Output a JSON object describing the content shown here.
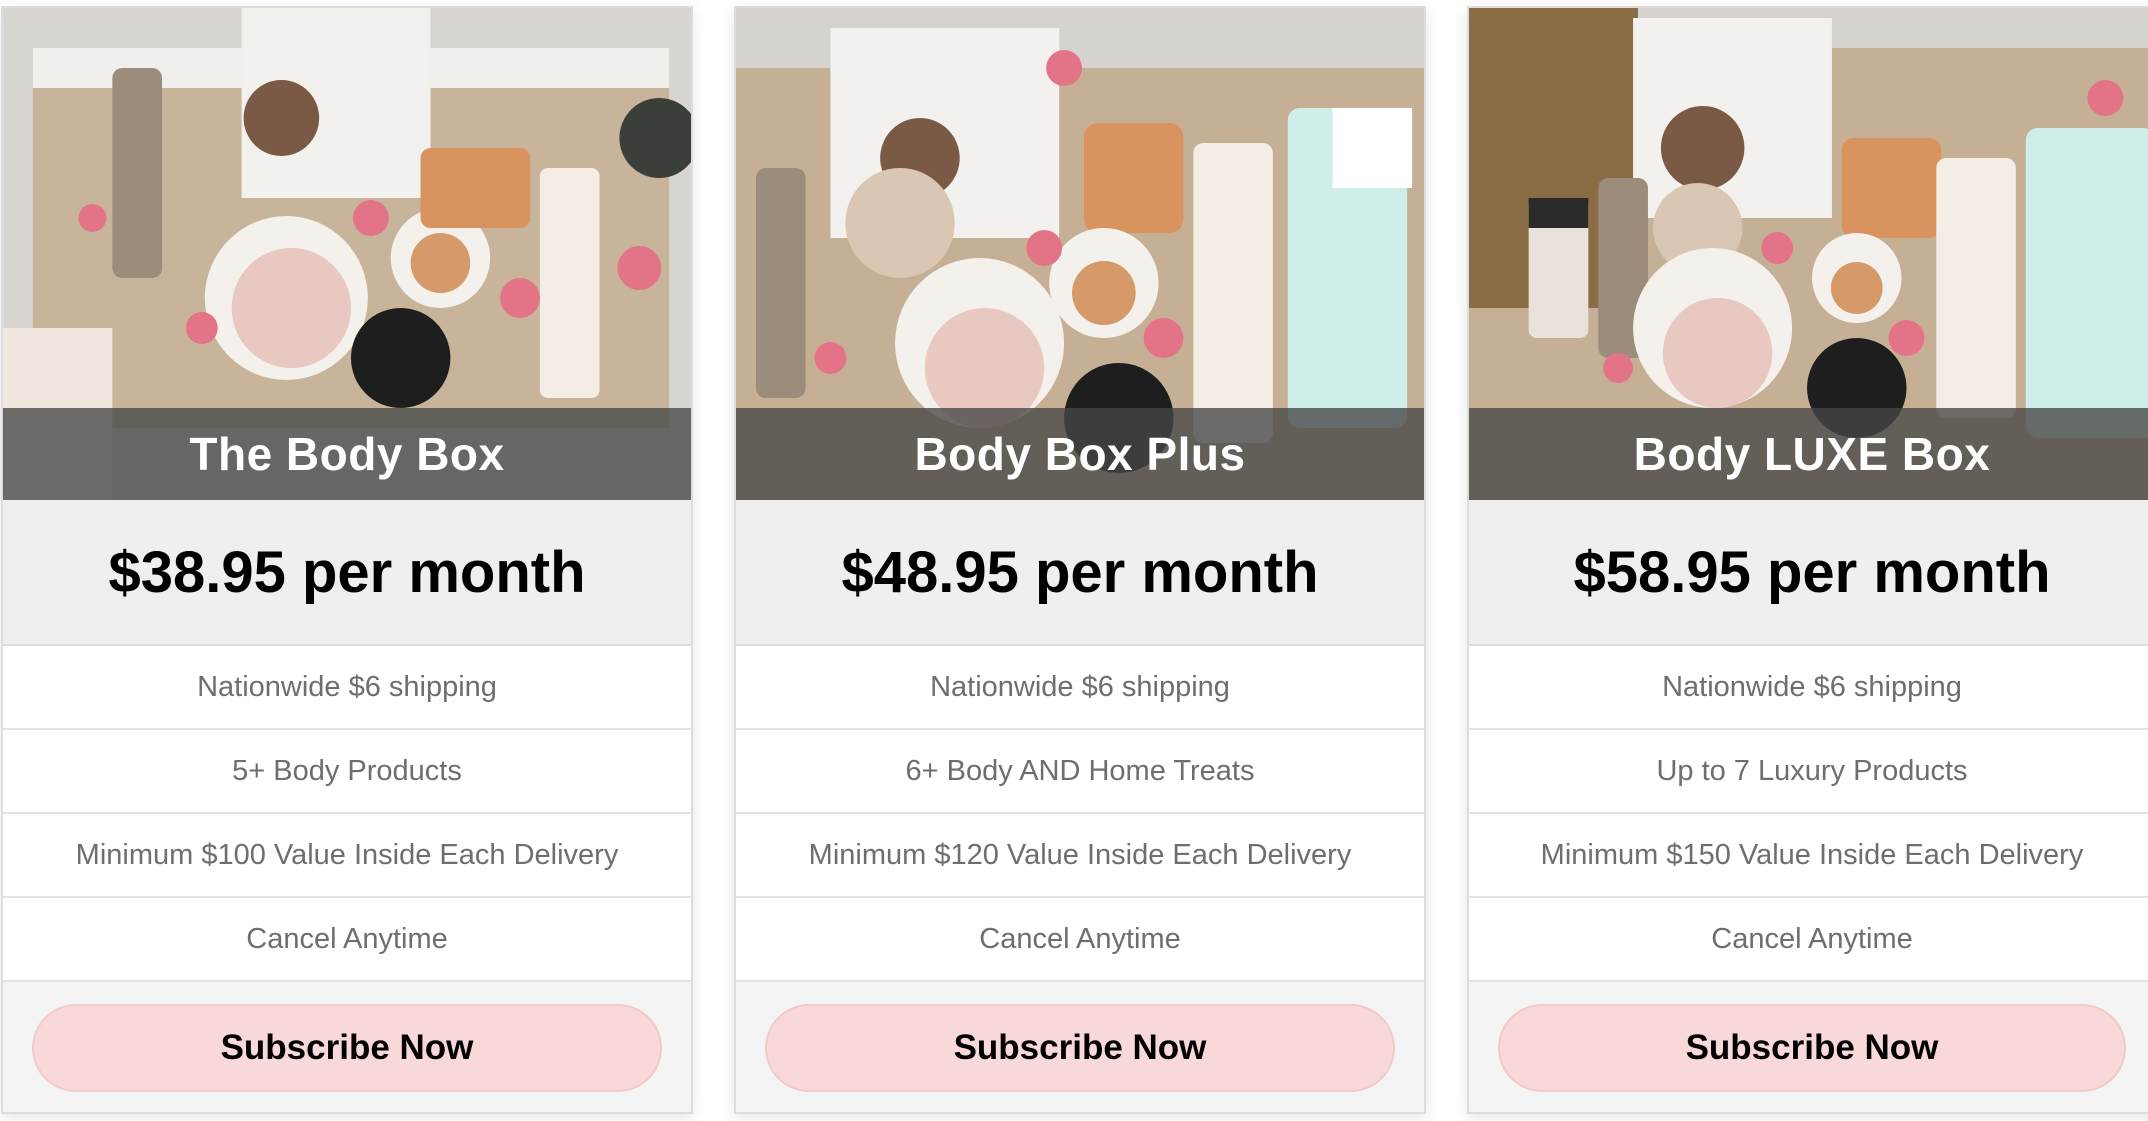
{
  "plans": [
    {
      "title": "The Body Box",
      "price": "$38.95 per month",
      "features": [
        "Nationwide $6 shipping",
        "5+ Body Products",
        "Minimum $100 Value Inside Each Delivery",
        "Cancel Anytime"
      ],
      "cta": "Subscribe Now"
    },
    {
      "title": "Body Box Plus",
      "price": "$48.95 per month",
      "features": [
        "Nationwide $6 shipping",
        "6+ Body AND Home Treats",
        "Minimum $120 Value Inside Each Delivery",
        "Cancel Anytime"
      ],
      "cta": "Subscribe Now"
    },
    {
      "title": "Body LUXE Box",
      "price": "$58.95 per month",
      "features": [
        "Nationwide $6 shipping",
        "Up to 7 Luxury Products",
        "Minimum $150 Value Inside Each Delivery",
        "Cancel Anytime"
      ],
      "cta": "Subscribe Now"
    }
  ],
  "colors": {
    "cta_bg": "#f8d8d8",
    "price_bg": "#efefef",
    "title_bar": "#464646"
  }
}
